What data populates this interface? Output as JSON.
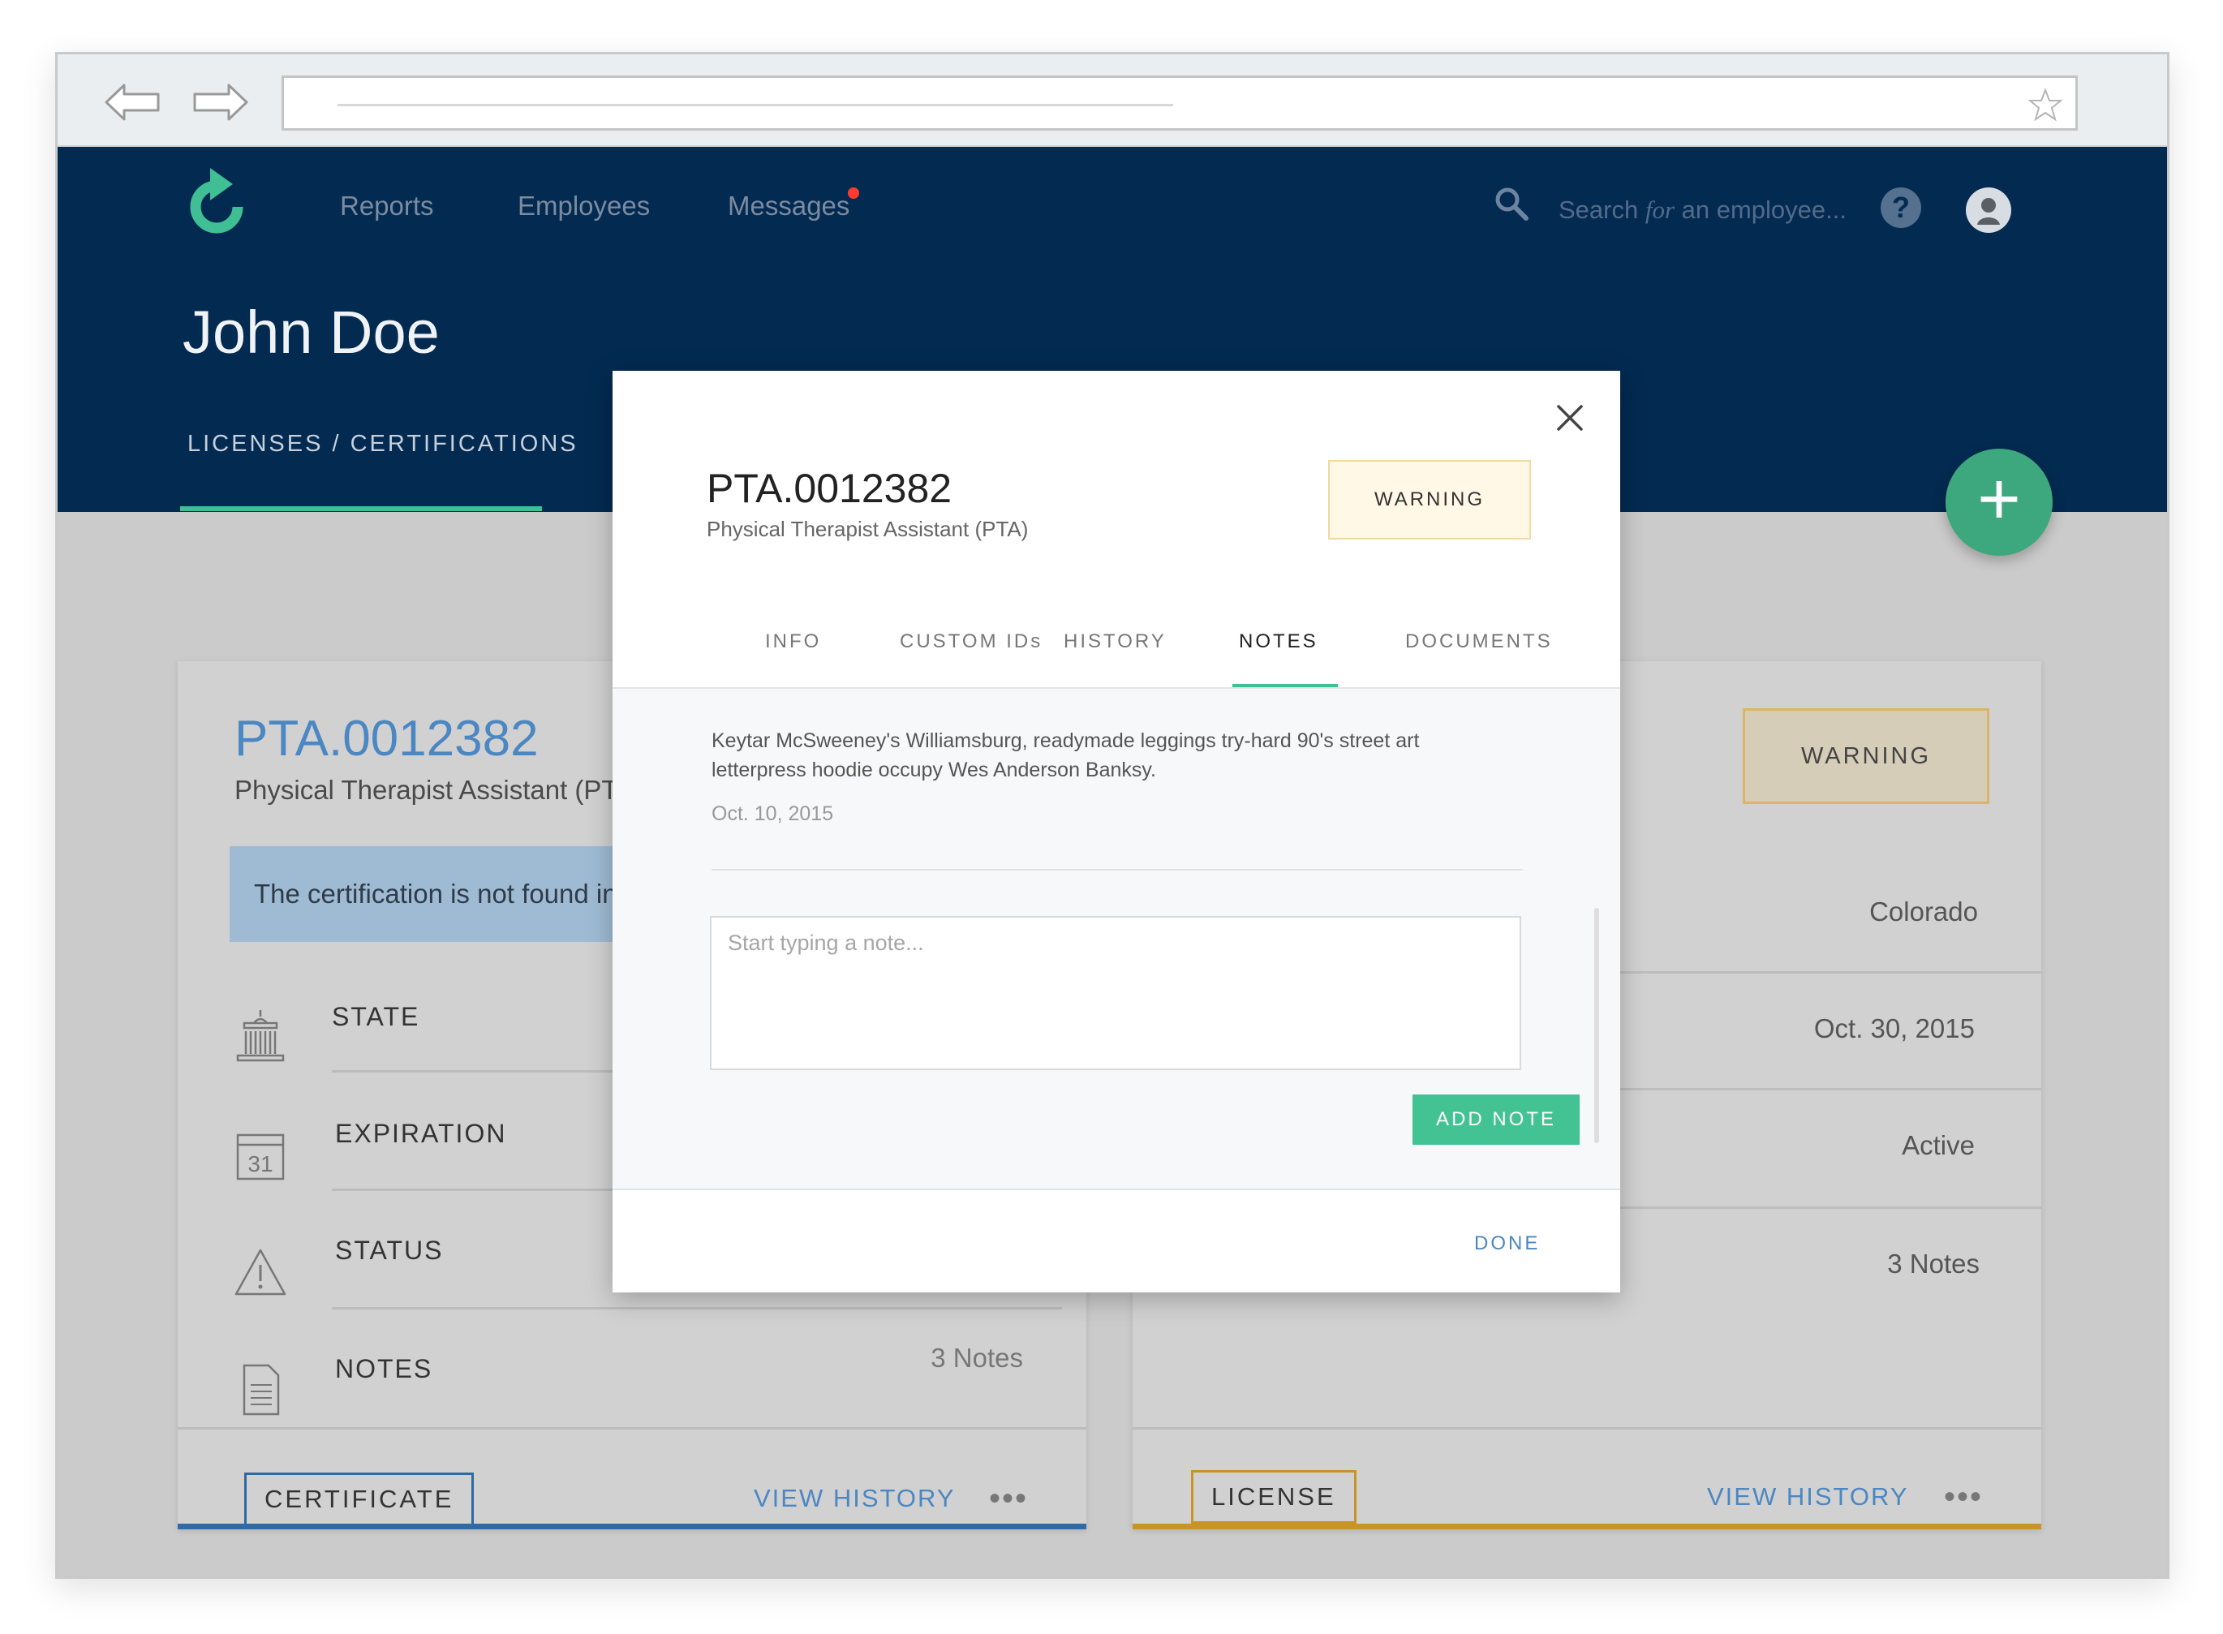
{
  "browser": {
    "back_icon": "back-arrow-icon",
    "forward_icon": "forward-arrow-icon",
    "bookmark_icon": "star-icon"
  },
  "nav": {
    "logo_icon": "refresh-arrow-logo-icon",
    "items": [
      "Reports",
      "Employees",
      "Messages"
    ],
    "messages_unread": true,
    "search_placeholder_pre": "Search ",
    "search_placeholder_italic": "for",
    "search_placeholder_post": " an employee...",
    "help_label": "?",
    "avatar_icon": "user-avatar-icon"
  },
  "page": {
    "title": "John Doe",
    "section_tab": "LICENSES / CERTIFICATIONS"
  },
  "left_card": {
    "title": "PTA.0012382",
    "subtitle": "Physical Therapist Assistant (PTA)",
    "alert": "The certification is not found in",
    "rows": [
      {
        "label": "STATE",
        "icon": "capitol-building-icon"
      },
      {
        "label": "EXPIRATION",
        "icon": "calendar-icon"
      },
      {
        "label": "STATUS",
        "icon": "warning-triangle-icon"
      },
      {
        "label": "NOTES",
        "icon": "document-icon"
      }
    ],
    "calendar_day": "31",
    "notes_count": "3 Notes",
    "tag": "CERTIFICATE",
    "view_history": "VIEW HISTORY",
    "more": "•••",
    "accent_color": "#2e6aa5"
  },
  "right_card": {
    "status": "WARNING",
    "state": "Colorado",
    "expiration": "Oct. 30, 2015",
    "status_value": "Active",
    "notes_count": "3 Notes",
    "tag": "LICENSE",
    "view_history": "VIEW HISTORY",
    "more": "•••",
    "accent_color": "#c99426"
  },
  "fab": {
    "label": "+"
  },
  "modal": {
    "title": "PTA.0012382",
    "subtitle": "Physical Therapist Assistant (PTA)",
    "status": "WARNING",
    "tabs": [
      "INFO",
      "CUSTOM IDs",
      "HISTORY",
      "NOTES",
      "DOCUMENTS"
    ],
    "active_tab": "NOTES",
    "note": {
      "text": "Keytar McSweeney's Williamsburg, readymade leggings try-hard 90's street art letterpress hoodie occupy Wes Anderson Banksy.",
      "date": "Oct. 10, 2015"
    },
    "note_placeholder": "Start typing a note...",
    "add_note_label": "ADD NOTE",
    "done_label": "DONE"
  },
  "colors": {
    "header_bg": "#032a51",
    "accent_green": "#3fbf93",
    "link_blue": "#4b87c2",
    "warning_border": "#f2d9a2"
  }
}
